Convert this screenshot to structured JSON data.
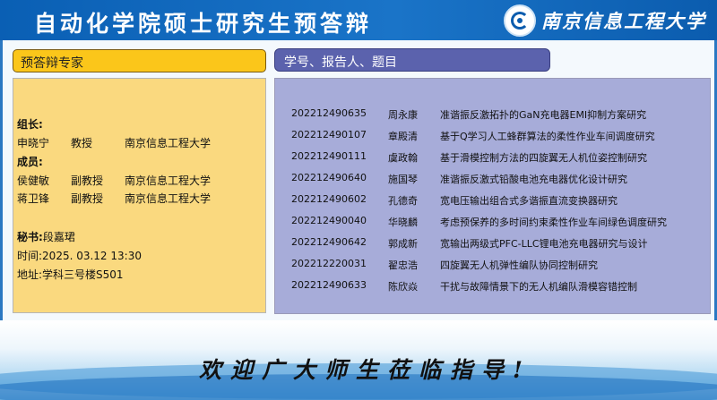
{
  "header": {
    "title": "自动化学院硕士研究生预答辩",
    "university": "南京信息工程大学",
    "logo_icon": "university-emblem-icon"
  },
  "left": {
    "header": "预答辩专家",
    "leader_label": "组长:",
    "leader": {
      "name": "申晓宁",
      "title": "教授",
      "org": "南京信息工程大学"
    },
    "members_label": "成员:",
    "members": [
      {
        "name": "侯健敏",
        "title": "副教授",
        "org": "南京信息工程大学"
      },
      {
        "name": "蒋卫锋",
        "title": "副教授",
        "org": "南京信息工程大学"
      }
    ],
    "secretary_label": "秘书:",
    "secretary": "段嘉珺",
    "time": "时间:2025. 03.12  13:30",
    "place": "地址:学科三号楼S501"
  },
  "right": {
    "header": "学号、报告人、题目",
    "rows": [
      {
        "id": "202212490635",
        "name": "周永康",
        "title": "准谐振反激拓扑的GaN充电器EMI抑制方案研究"
      },
      {
        "id": "202212490107",
        "name": "章殿清",
        "title": "基于Q学习人工蜂群算法的柔性作业车间调度研究"
      },
      {
        "id": "202212490111",
        "name": "虞政翰",
        "title": "基于滑模控制方法的四旋翼无人机位姿控制研究"
      },
      {
        "id": "202212490640",
        "name": "施国琴",
        "title": "准谐振反激式铅酸电池充电器优化设计研究"
      },
      {
        "id": "202212490602",
        "name": "孔德奇",
        "title": "宽电压输出组合式多谐振直流变换器研究"
      },
      {
        "id": "202212490040",
        "name": "华晓麟",
        "title": "考虑预保养的多时间约束柔性作业车间绿色调度研究"
      },
      {
        "id": "202212490642",
        "name": "郭成新",
        "title": "宽输出两级式PFC-LLC锂电池充电器研究与设计"
      },
      {
        "id": "202212220031",
        "name": "翟忠浩",
        "title": "四旋翼无人机弹性编队协同控制研究"
      },
      {
        "id": "202212490633",
        "name": "陈欣焱",
        "title": "干扰与故障情景下的无人机编队滑模容错控制"
      }
    ]
  },
  "footer": {
    "text": "欢迎广大师生莅临指导!"
  }
}
